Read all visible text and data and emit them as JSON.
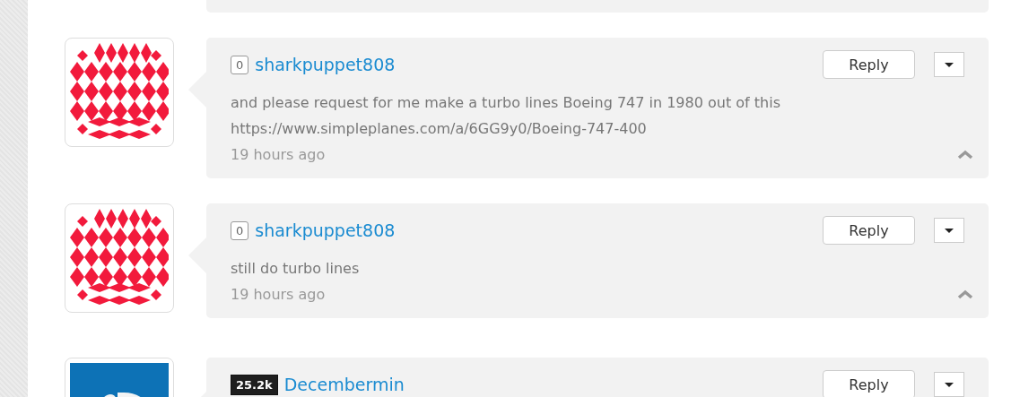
{
  "comments": [
    {
      "avatar": {
        "kind": "identicon"
      },
      "badge": {
        "kind": "plain",
        "text": "0"
      },
      "username": "sharkpuppet808",
      "text": "and please request for me make a turbo lines Boeing 747 in 1980 out of this\nhttps://www.simpleplanes.com/a/6GG9y0/Boeing-747-400",
      "time": "19 hours ago",
      "reply": "Reply",
      "collapsible": true
    },
    {
      "avatar": {
        "kind": "identicon"
      },
      "badge": {
        "kind": "plain",
        "text": "0"
      },
      "username": "sharkpuppet808",
      "text": "still do turbo lines",
      "time": "19 hours ago",
      "reply": "Reply",
      "collapsible": true
    },
    {
      "avatar": {
        "kind": "logo"
      },
      "badge": {
        "kind": "dark",
        "text": "25.2k"
      },
      "username": "Decembermin",
      "reply": "Reply"
    }
  ]
}
